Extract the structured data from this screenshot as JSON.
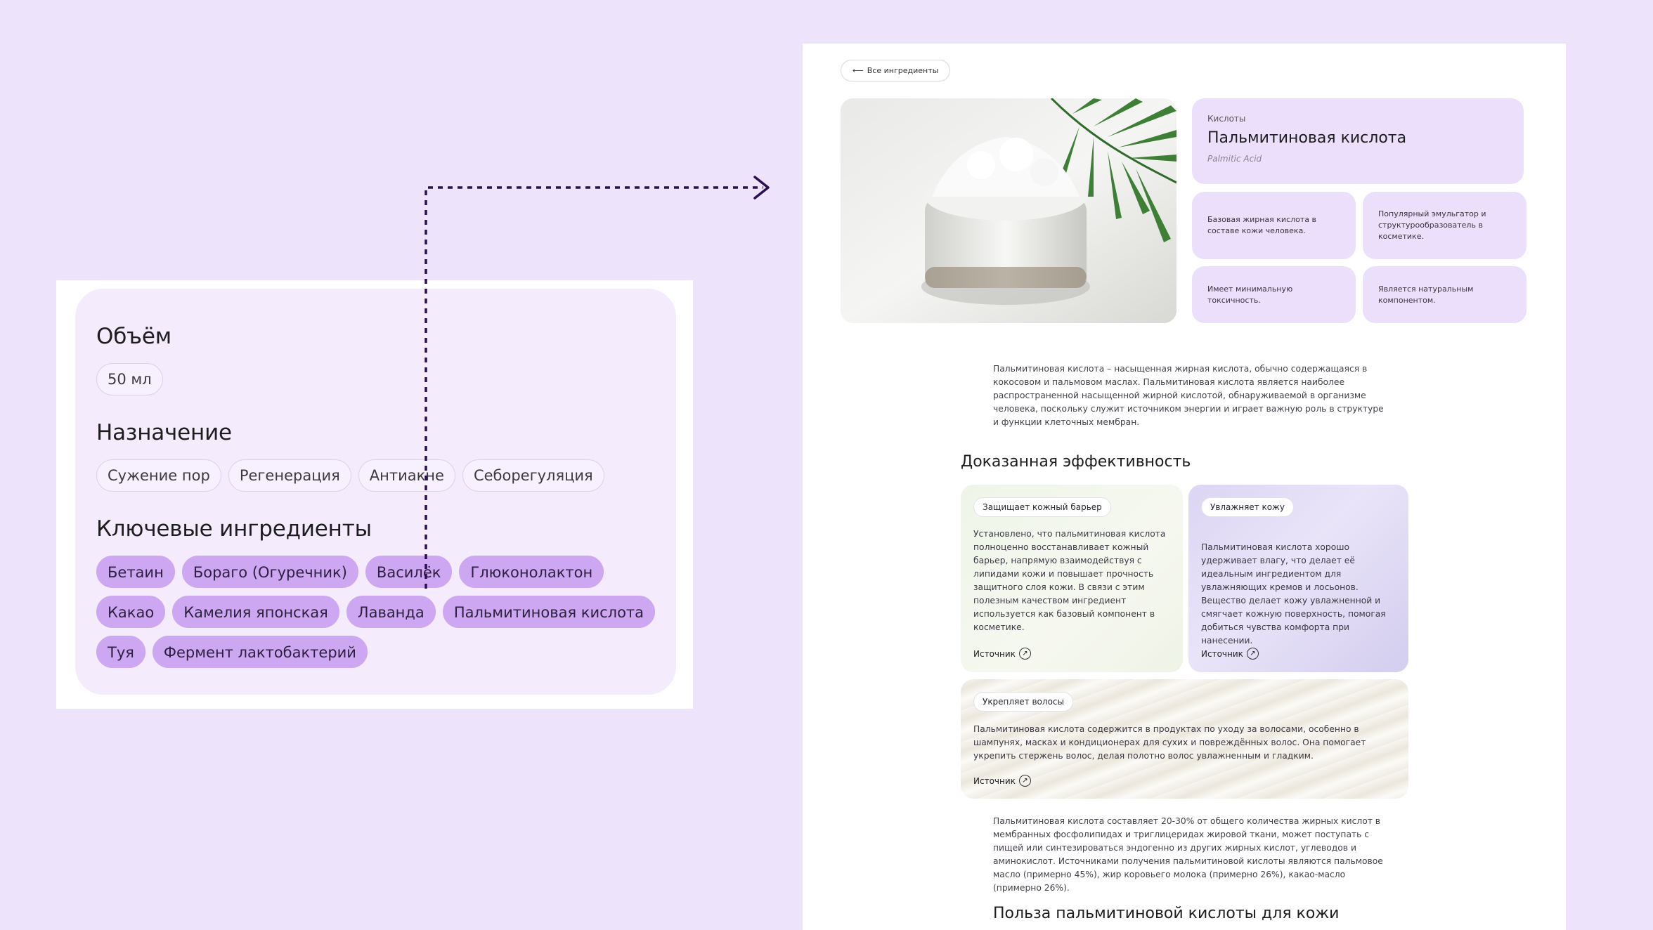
{
  "left": {
    "volume": {
      "title": "Объём",
      "options": [
        "50 мл"
      ]
    },
    "purpose": {
      "title": "Назначение",
      "options": [
        "Сужение пор",
        "Регенерация",
        "Антиакне",
        "Себорегуляция"
      ]
    },
    "ingredients": {
      "title": "Ключевые ингредиенты",
      "items": [
        "Бетаин",
        "Бораго (Огуречник)",
        "Василёк",
        "Глюконолактон",
        "Какао",
        "Камелия японская",
        "Лаванда",
        "Пальмитиновая кислота",
        "Туя",
        "Фермент лактобактерий"
      ]
    }
  },
  "right": {
    "back_label": "Все ингредиенты",
    "category": "Кислоты",
    "title": "Пальмитиновая кислота",
    "latin": "Palmitic Acid",
    "facts": [
      "Базовая жирная кислота в составе кожи человека.",
      "Популярный эмульгатор и структурообразователь в косметике.",
      "Имеет минимальную токсичность.",
      "Является натуральным компонентом."
    ],
    "intro": "Пальмитиновая кислота – насыщенная жирная кислота, обычно содержащаяся в кокосовом и пальмовом маслах. Пальмитиновая кислота является наиболее распространенной насыщенной жирной кислотой, обнаруживаемой в организме человека, поскольку служит источником энергии и играет важную роль в структуре и функции клеточных мембран.",
    "efficacy_title": "Доказанная эффективность",
    "efficacy": [
      {
        "tag": "Защищает кожный барьер",
        "text": "Установлено, что пальмитиновая кислота полноценно восстанавливает кожный барьер, напрямую взаимодействуя с липидами кожи и повышает прочность защитного слоя кожи. В связи с этим полезным качеством ингредиент используется как базовый компонент в косметике.",
        "source": "Источник"
      },
      {
        "tag": "Увлажняет кожу",
        "text": "Пальмитиновая кислота хорошо удерживает влагу, что делает её идеальным ингредиентом для увлажняющих кремов и лосьонов. Вещество делает кожу увлажненной и смягчает кожную поверхность, помогая добиться чувства комфорта при нанесении.",
        "source": "Источник"
      },
      {
        "tag": "Укрепляет волосы",
        "text": "Пальмитиновая кислота содержится в продуктах по уходу за волосами, особенно в шампунях, масках и кондиционерах для сухих и повреждённых волос. Она помогает укрепить стержень волос, делая полотно волос увлажненным и гладким.",
        "source": "Источник"
      }
    ],
    "sources_text": "Пальмитиновая кислота составляет 20-30% от общего количества жирных кислот в мембранных фосфолипидах и триглицеридах жировой ткани, может поступать с пищей или синтезироваться эндогенно из других жирных кислот, углеводов и аминокислот. Источниками получения пальмитиновой кислоты являются пальмовое масло (примерно 45%), жир коровьего молока (примерно 26%), какао-масло (примерно 26%).",
    "benefit_title": "Польза пальмитиновой кислоты для кожи"
  },
  "colors": {
    "background": "#ede3fb",
    "chip_filled": "#cda7f1",
    "card_lilac": "#ebdffb",
    "arrow": "#2a0f52"
  }
}
